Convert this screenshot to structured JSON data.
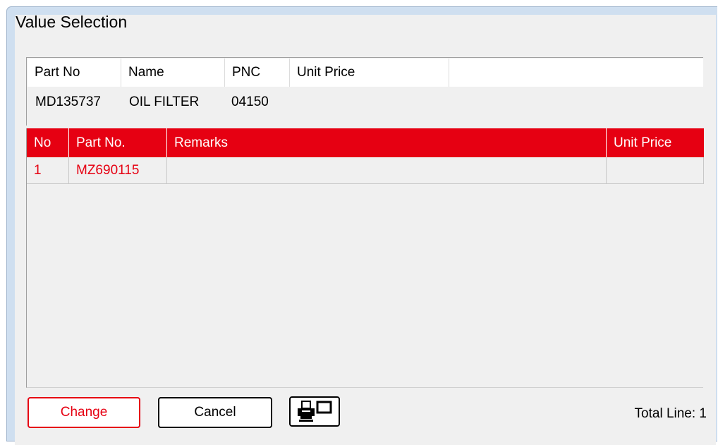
{
  "window": {
    "title": "Value Selection"
  },
  "info": {
    "headers": {
      "part_no": "Part No",
      "name": "Name",
      "pnc": "PNC",
      "unit_price": "Unit Price"
    },
    "values": {
      "part_no": "MD135737",
      "name": "OIL FILTER",
      "pnc": "04150",
      "unit_price": ""
    }
  },
  "grid": {
    "headers": {
      "no": "No",
      "part_no": "Part No.",
      "remarks": "Remarks",
      "unit_price": "Unit Price"
    },
    "rows": [
      {
        "no": "1",
        "part_no": "MZ690115",
        "remarks": "",
        "unit_price": ""
      }
    ]
  },
  "buttons": {
    "change": "Change",
    "cancel": "Cancel",
    "print_icon": "print-preview-icon"
  },
  "status": {
    "total_line": "Total Line: 1"
  },
  "colors": {
    "accent": "#e60012",
    "panel_bg": "#f0f0f0",
    "frame": "#cfdff0"
  }
}
